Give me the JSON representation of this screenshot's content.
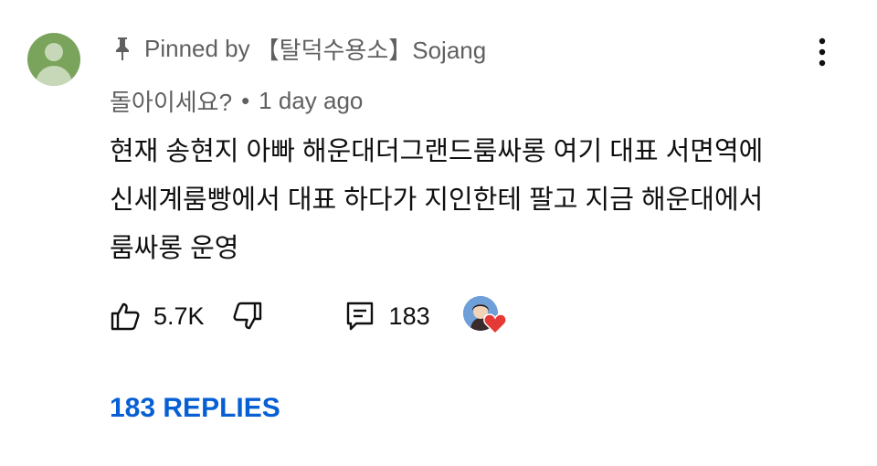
{
  "comment": {
    "pinned_prefix": "Pinned by",
    "pinned_channel": "【탈덕수용소】Sojang",
    "author": "돌아이세요?",
    "separator": "•",
    "time": "1 day ago",
    "text_lines": [
      "현재 송현지 아빠 해운대더그랜드룸싸롱 여기 대표 서면역에",
      "신세계룸빵에서 대표 하다가 지인한테 팔고 지금 해운대에서",
      "룸싸롱 운영"
    ],
    "like_count": "5.7K",
    "reply_count": "183",
    "view_replies_label": "183 REPLIES"
  },
  "colors": {
    "avatar": "#7aa35b",
    "secondary_text": "#606060",
    "link": "#065fd4",
    "heart": "#e53935"
  },
  "icons": {
    "pin": "pin-icon",
    "more": "more-vertical-icon",
    "like": "thumbs-up-icon",
    "dislike": "thumbs-down-icon",
    "reply": "comment-icon",
    "creator_heart": "heart-icon"
  }
}
